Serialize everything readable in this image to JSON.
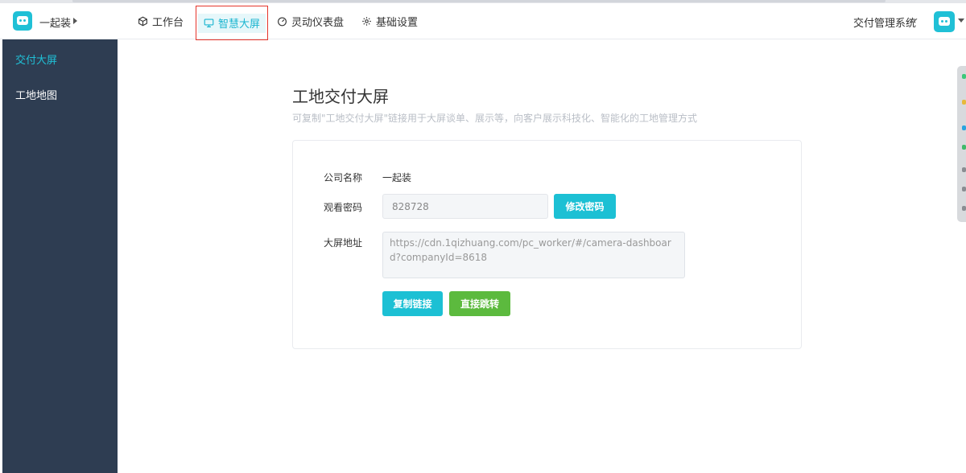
{
  "header": {
    "company_name": "一起装",
    "nav": [
      {
        "label": "工作台",
        "icon": "cube-icon"
      },
      {
        "label": "智慧大屏",
        "icon": "monitor-icon"
      },
      {
        "label": "灵动仪表盘",
        "icon": "speedometer-icon"
      },
      {
        "label": "基础设置",
        "icon": "gear-icon"
      }
    ],
    "system_name": "交付管理系统"
  },
  "sidebar": {
    "items": [
      {
        "label": "交付大屏",
        "active": true
      },
      {
        "label": "工地地图",
        "active": false
      }
    ]
  },
  "main": {
    "title": "工地交付大屏",
    "subtitle": "可复制\"工地交付大屏\"链接用于大屏谈单、展示等，向客户展示科技化、智能化的工地管理方式",
    "form": {
      "company_label": "公司名称",
      "company_value": "一起装",
      "password_label": "观看密码",
      "password_value": "828728",
      "modify_button": "修改密码",
      "url_label": "大屏地址",
      "url_value": "https://cdn.1qizhuang.com/pc_worker/#/camera-dashboard?companyId=8618",
      "copy_button": "复制链接",
      "jump_button": "直接跳转"
    }
  },
  "colors": {
    "accent": "#1cc0d4",
    "success": "#5cba3e",
    "sidebar_bg": "#2e3d52",
    "highlight_border": "#e5352b"
  }
}
